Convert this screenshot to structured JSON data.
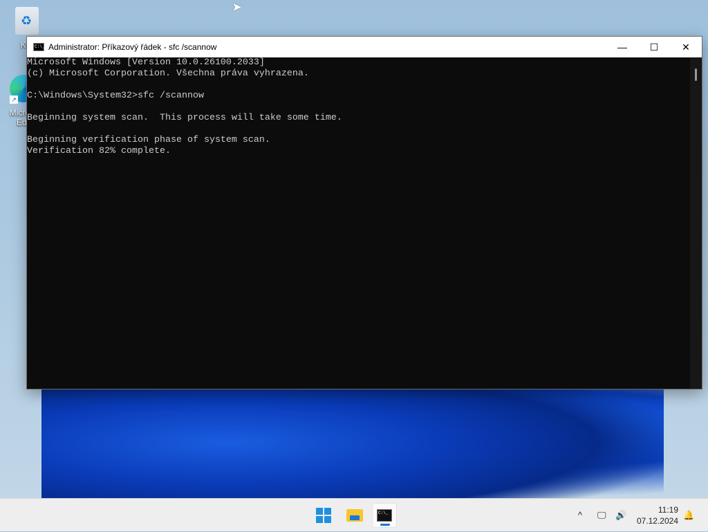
{
  "desktop": {
    "icons": [
      {
        "label": "Koš"
      },
      {
        "label": "Microsoft Edge"
      }
    ]
  },
  "window": {
    "title": "Administrator: Příkazový řádek - sfc  /scannow",
    "minimize": "—",
    "maximize": "☐",
    "close": "✕",
    "console_lines": [
      "Microsoft Windows [Version 10.0.26100.2033]",
      "(c) Microsoft Corporation. Všechna práva vyhrazena.",
      "",
      "C:\\Windows\\System32>sfc /scannow",
      "",
      "Beginning system scan.  This process will take some time.",
      "",
      "Beginning verification phase of system scan.",
      "Verification 82% complete."
    ]
  },
  "taskbar": {
    "time": "11:19",
    "date": "07.12.2024",
    "chevron": "^",
    "network": "🖵",
    "volume": "🔊",
    "notifications": "🔔"
  }
}
